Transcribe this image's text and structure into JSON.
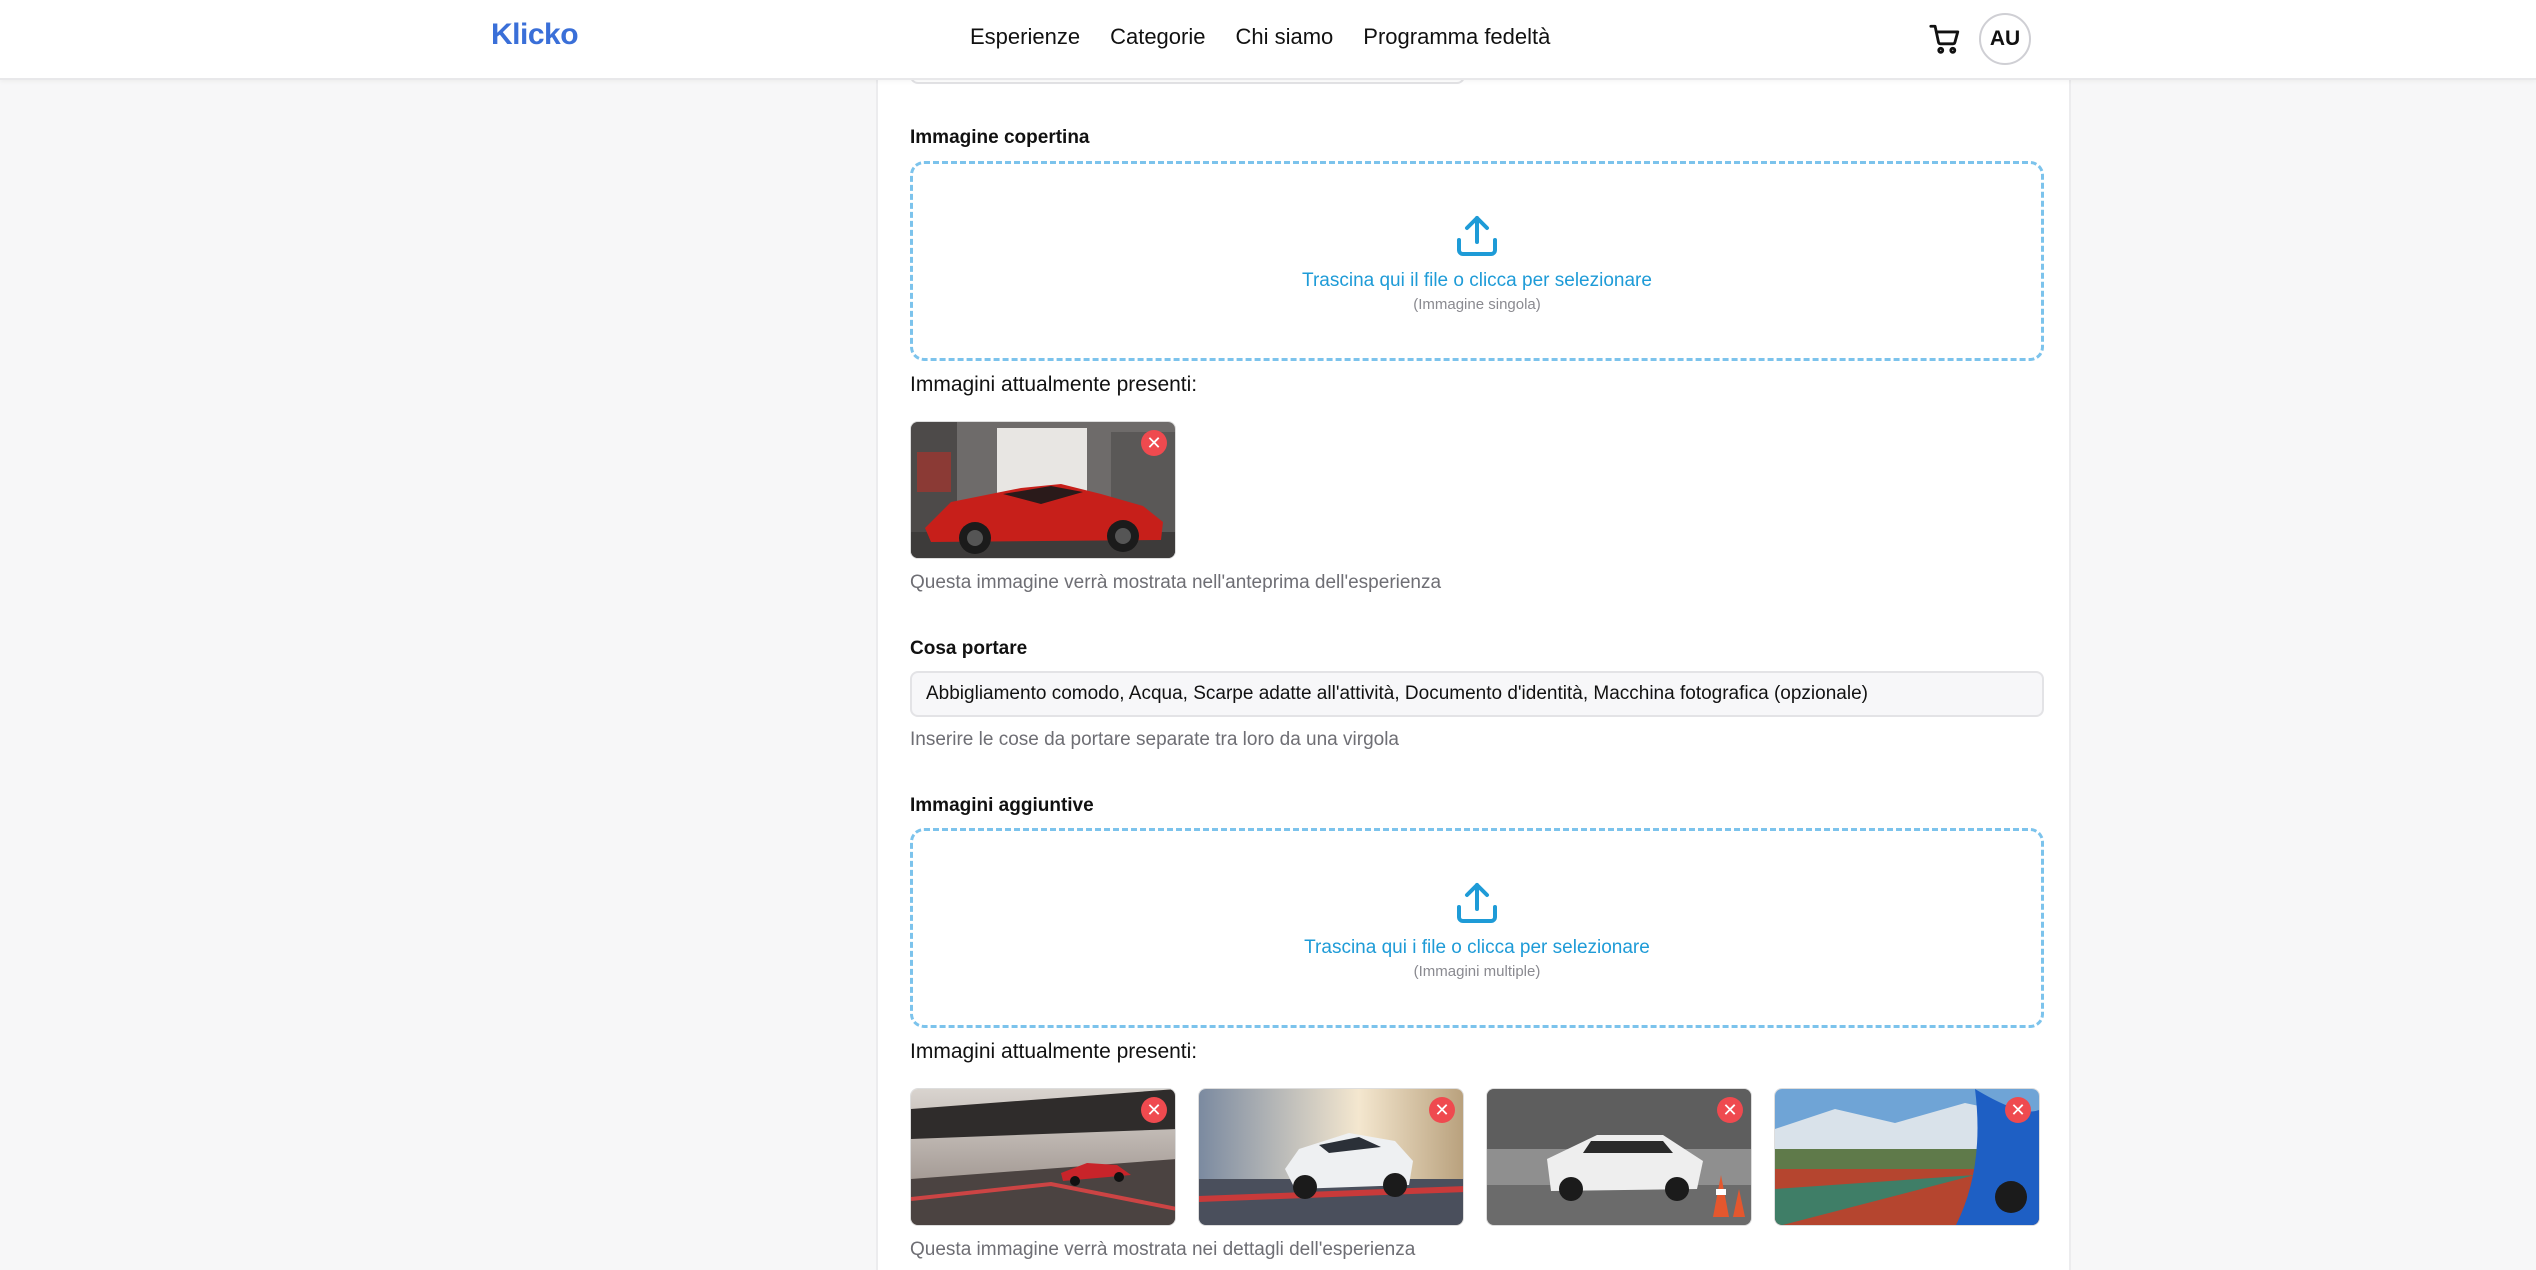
{
  "header": {
    "logo": "Klicko",
    "nav": [
      "Esperienze",
      "Categorie",
      "Chi siamo",
      "Programma fedeltà"
    ],
    "avatar_initials": "AU",
    "cart_icon": "cart-icon"
  },
  "form": {
    "cover": {
      "label": "Immagine copertina",
      "dropzone_text": "Trascina qui il file o clicca per selezionare",
      "dropzone_sub": "(Immagine singola)",
      "present_title": "Immagini attualmente presenti:",
      "hint": "Questa immagine verrà mostrata nell'anteprima dell'esperienza",
      "images": [
        "red-sports-car-photo"
      ]
    },
    "bring": {
      "label": "Cosa portare",
      "value": "Abbigliamento comodo, Acqua, Scarpe adatte all'attività, Documento d'identità, Macchina fotografica (opzionale)",
      "hint": "Inserire le cose da portare separate tra loro da una virgola"
    },
    "additional": {
      "label": "Immagini aggiuntive",
      "dropzone_text": "Trascina qui i file o clicca per selezionare",
      "dropzone_sub": "(Immagini multiple)",
      "present_title": "Immagini attualmente presenti:",
      "hint": "Questa immagine verrà mostrata nei dettagli dell'esperienza",
      "images": [
        "car-on-track-sunset-photo",
        "white-race-car-photo",
        "white-sports-car-cones-photo",
        "blue-car-racetrack-photo"
      ]
    },
    "remove_symbol": "✕"
  },
  "colors": {
    "brand": "#3a6fd8",
    "accent": "#1e9bd7",
    "danger": "#ef4a4f"
  }
}
